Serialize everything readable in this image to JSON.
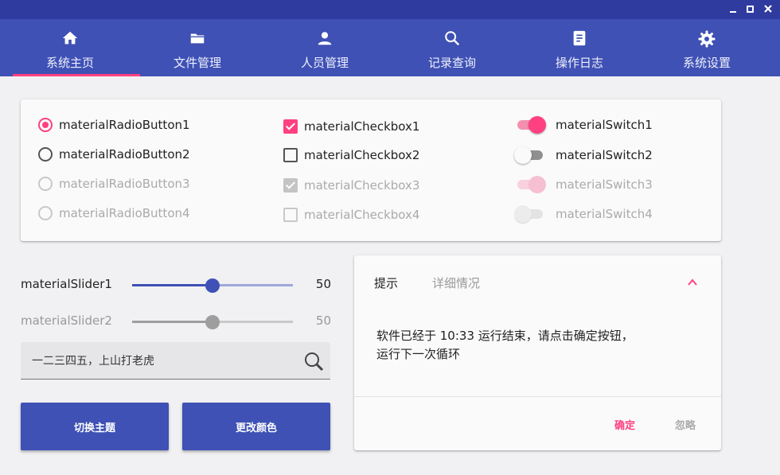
{
  "window": {
    "minimize_icon": "minimize-icon",
    "maximize_icon": "maximize-icon",
    "close_icon": "close-icon"
  },
  "nav": {
    "items": [
      {
        "label": "系统主页",
        "icon": "home-icon",
        "active": true
      },
      {
        "label": "文件管理",
        "icon": "folder-icon",
        "active": false
      },
      {
        "label": "人员管理",
        "icon": "person-icon",
        "active": false
      },
      {
        "label": "记录查询",
        "icon": "search-icon",
        "active": false
      },
      {
        "label": "操作日志",
        "icon": "notebook-icon",
        "active": false
      },
      {
        "label": "系统设置",
        "icon": "gear-icon",
        "active": false
      }
    ],
    "indicator_color": "#ff4081"
  },
  "radios": [
    {
      "label": "materialRadioButton1",
      "checked": true,
      "enabled": true
    },
    {
      "label": "materialRadioButton2",
      "checked": false,
      "enabled": true
    },
    {
      "label": "materialRadioButton3",
      "checked": false,
      "enabled": false
    },
    {
      "label": "materialRadioButton4",
      "checked": false,
      "enabled": false
    }
  ],
  "checkboxes": [
    {
      "label": "materialCheckbox1",
      "checked": true,
      "enabled": true
    },
    {
      "label": "materialCheckbox2",
      "checked": false,
      "enabled": true
    },
    {
      "label": "materialCheckbox3",
      "checked": true,
      "enabled": false
    },
    {
      "label": "materialCheckbox4",
      "checked": false,
      "enabled": false
    }
  ],
  "switches": [
    {
      "label": "materialSwitch1",
      "on": true,
      "enabled": true
    },
    {
      "label": "materialSwitch2",
      "on": false,
      "enabled": true
    },
    {
      "label": "materialSwitch3",
      "on": true,
      "enabled": false
    },
    {
      "label": "materialSwitch4",
      "on": false,
      "enabled": false
    }
  ],
  "sliders": [
    {
      "label": "materialSlider1",
      "value": "50",
      "fraction": 0.5,
      "enabled": true
    },
    {
      "label": "materialSlider2",
      "value": "50",
      "fraction": 0.5,
      "enabled": false
    }
  ],
  "search": {
    "value": "一二三四五，上山打老虎",
    "icon": "magnifier-icon"
  },
  "buttons": {
    "switch_theme": "切换主题",
    "change_color": "更改颜色"
  },
  "dialog": {
    "tab_hint": "提示",
    "tab_details": "详细情况",
    "collapse_icon": "chevron-up-icon",
    "message_line1": "软件已经于 10:33 运行结束，请点击确定按钮，",
    "message_line2": "运行下一次循环",
    "ok_label": "确定",
    "ignore_label": "忽略"
  },
  "colors": {
    "primary": "#3f51b5",
    "accent": "#ff4081",
    "titlebar": "#2f3b9f"
  }
}
